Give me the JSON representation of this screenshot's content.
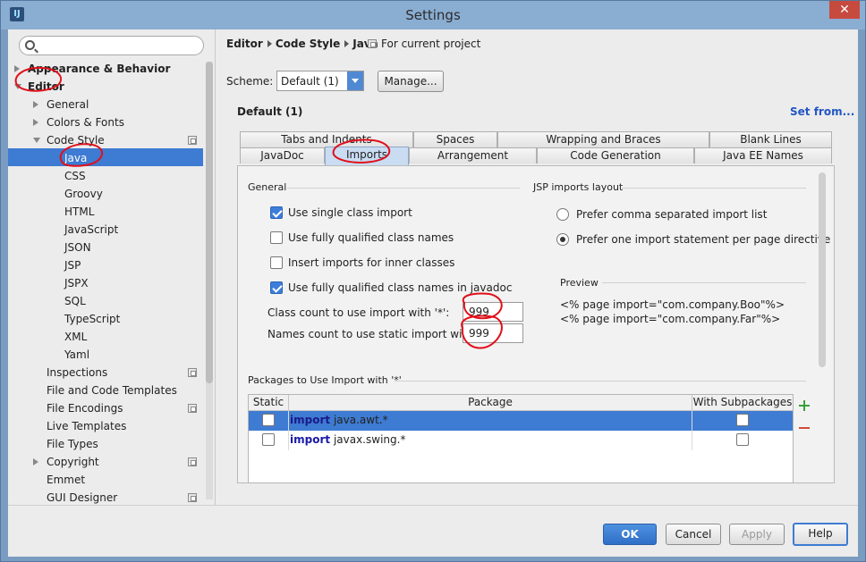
{
  "window": {
    "title": "Settings",
    "app_icon_text": "IJ",
    "close_glyph": "✕"
  },
  "search": {
    "placeholder": ""
  },
  "tree": {
    "items": [
      {
        "label": "Appearance & Behavior",
        "bold": true
      },
      {
        "label": "Editor",
        "bold": true
      },
      {
        "label": "General"
      },
      {
        "label": "Colors & Fonts"
      },
      {
        "label": "Code Style"
      },
      {
        "label": "Java",
        "selected": true
      },
      {
        "label": "CSS"
      },
      {
        "label": "Groovy"
      },
      {
        "label": "HTML"
      },
      {
        "label": "JavaScript"
      },
      {
        "label": "JSON"
      },
      {
        "label": "JSP"
      },
      {
        "label": "JSPX"
      },
      {
        "label": "SQL"
      },
      {
        "label": "TypeScript"
      },
      {
        "label": "XML"
      },
      {
        "label": "Yaml"
      },
      {
        "label": "Inspections"
      },
      {
        "label": "File and Code Templates"
      },
      {
        "label": "File Encodings"
      },
      {
        "label": "Live Templates"
      },
      {
        "label": "File Types"
      },
      {
        "label": "Copyright"
      },
      {
        "label": "Emmet"
      },
      {
        "label": "GUI Designer"
      }
    ]
  },
  "breadcrumb": {
    "parts": [
      "Editor",
      "Code Style",
      "Java"
    ],
    "for_project": "For current project"
  },
  "scheme": {
    "label": "Scheme:",
    "value": "Default (1)",
    "manage": "Manage...",
    "name": "Default (1)",
    "set_from": "Set from..."
  },
  "tabs": {
    "top": [
      "Tabs and Indents",
      "Spaces",
      "Wrapping and Braces",
      "Blank Lines"
    ],
    "bottom": [
      "JavaDoc",
      "Imports",
      "Arrangement",
      "Code Generation",
      "Java EE Names"
    ],
    "active": "Imports"
  },
  "general": {
    "title": "General",
    "options": [
      {
        "label": "Use single class import",
        "checked": true
      },
      {
        "label": "Use fully qualified class names",
        "checked": false
      },
      {
        "label": "Insert imports for inner classes",
        "checked": false
      },
      {
        "label": "Use fully qualified class names in javadoc",
        "checked": true
      }
    ],
    "class_count_label": "Class count to use import with '*':",
    "class_count": "999",
    "names_count_label": "Names count to use static import with '*':",
    "names_count": "999"
  },
  "jsp": {
    "title": "JSP imports layout",
    "options": [
      {
        "label": "Prefer comma separated import list",
        "selected": false
      },
      {
        "label": "Prefer one import statement per page directive",
        "selected": true
      }
    ],
    "preview_title": "Preview",
    "preview_lines": [
      "<% page import=\"com.company.Boo\"%>",
      "<% page import=\"com.company.Far\"%>"
    ]
  },
  "packages": {
    "title": "Packages to Use Import with '*'",
    "columns": [
      "Static",
      "Package",
      "With Subpackages"
    ],
    "rows": [
      {
        "keyword": "import",
        "package": "java.awt.*",
        "static": false,
        "subpackages": false,
        "selected": true
      },
      {
        "keyword": "import",
        "package": "javax.swing.*",
        "static": false,
        "subpackages": false,
        "selected": false
      }
    ]
  },
  "buttons": {
    "ok": "OK",
    "cancel": "Cancel",
    "apply": "Apply",
    "help": "Help"
  },
  "colors": {
    "selection": "#3e7bd2",
    "annotation": "#e0101a",
    "link": "#2255c4"
  }
}
